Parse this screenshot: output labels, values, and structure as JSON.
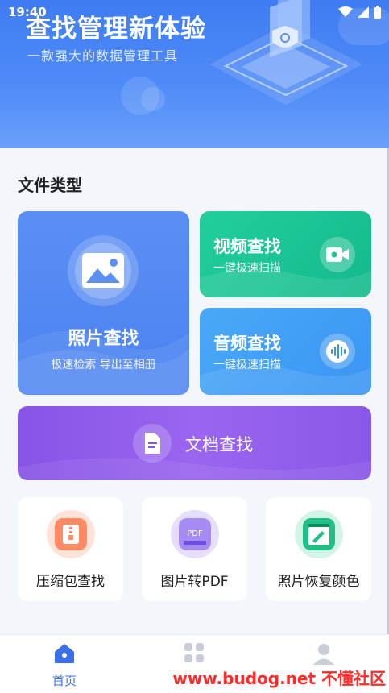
{
  "status_bar": {
    "time": "19:40"
  },
  "header": {
    "title": "查找管理新体验",
    "subtitle": "一款强大的数据管理工具"
  },
  "file_types": {
    "section_title": "文件类型",
    "photo": {
      "title": "照片查找",
      "subtitle": "极速检索 导出至相册"
    },
    "video": {
      "title": "视频查找",
      "subtitle": "一键极速扫描"
    },
    "audio": {
      "title": "音频查找",
      "subtitle": "一键极速扫描"
    },
    "document": {
      "title": "文档查找"
    }
  },
  "tools": [
    {
      "label": "压缩包查找",
      "icon": "zip-icon",
      "color": "#ff8a65"
    },
    {
      "label": "图片转PDF",
      "icon": "pdf-icon",
      "color": "#8f73f0",
      "icon_text": "PDF"
    },
    {
      "label": "照片恢复颜色",
      "icon": "paint-icon",
      "color": "#1fbf86"
    }
  ],
  "bottom_nav": {
    "home_label": "首页",
    "active": "home",
    "accent": "#3a6fe8"
  },
  "watermark": "www.budog.net 不懂社区"
}
